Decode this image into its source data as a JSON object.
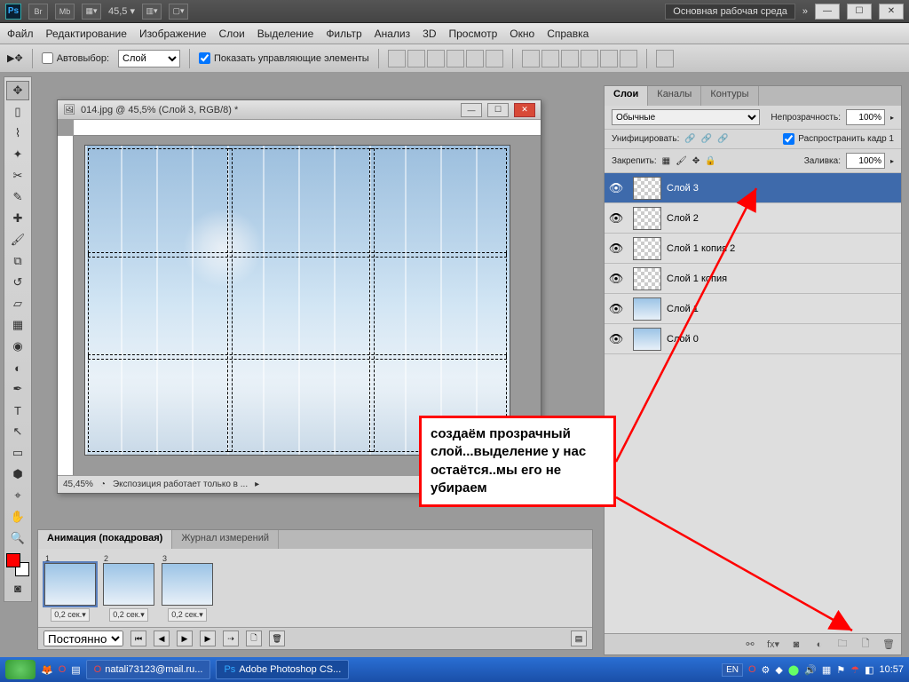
{
  "app_bar": {
    "ps": "Ps",
    "br": "Br",
    "mb": "Mb",
    "zoom": "45,5",
    "workspace": "Основная рабочая среда",
    "chevrons": "»"
  },
  "menu": {
    "file": "Файл",
    "edit": "Редактирование",
    "image": "Изображение",
    "layers": "Слои",
    "select": "Выделение",
    "filter": "Фильтр",
    "analysis": "Анализ",
    "threeD": "3D",
    "view": "Просмотр",
    "window": "Окно",
    "help": "Справка"
  },
  "options": {
    "autoselect": "Автовыбор:",
    "target": "Слой",
    "show_controls": "Показать управляющие элементы"
  },
  "doc": {
    "title": "014.jpg @ 45,5% (Слой 3, RGB/8) *",
    "status_zoom": "45,45%",
    "status_text": "Экспозиция работает только в ..."
  },
  "annotation": {
    "text": "создаём прозрачный слой...выделение у нас остаётся..мы его не убираем"
  },
  "panels": {
    "layers_tab": "Слои",
    "channels_tab": "Каналы",
    "paths_tab": "Контуры",
    "blend_mode": "Обычные",
    "opacity_label": "Непрозрачность:",
    "opacity_value": "100%",
    "unify_label": "Унифицировать:",
    "propagate": "Распространить кадр 1",
    "lock_label": "Закрепить:",
    "fill_label": "Заливка:",
    "fill_value": "100%",
    "layers": [
      {
        "name": "Слой 3",
        "selected": true,
        "transparent": true
      },
      {
        "name": "Слой 2",
        "selected": false,
        "transparent": true
      },
      {
        "name": "Слой 1 копия 2",
        "selected": false,
        "transparent": true
      },
      {
        "name": "Слой 1 копия",
        "selected": false,
        "transparent": true
      },
      {
        "name": "Слой 1",
        "selected": false,
        "transparent": false
      },
      {
        "name": "Слой 0",
        "selected": false,
        "transparent": false
      }
    ]
  },
  "animation": {
    "tab1": "Анимация (покадровая)",
    "tab2": "Журнал измерений",
    "loop": "Постоянно",
    "frames": [
      {
        "num": "1",
        "delay": "0,2 сек."
      },
      {
        "num": "2",
        "delay": "0,2 сек."
      },
      {
        "num": "3",
        "delay": "0,2 сек."
      }
    ]
  },
  "taskbar": {
    "mail": "natali73123@mail.ru...",
    "ps": "Adobe Photoshop CS...",
    "lang": "EN",
    "clock": "10:57"
  }
}
